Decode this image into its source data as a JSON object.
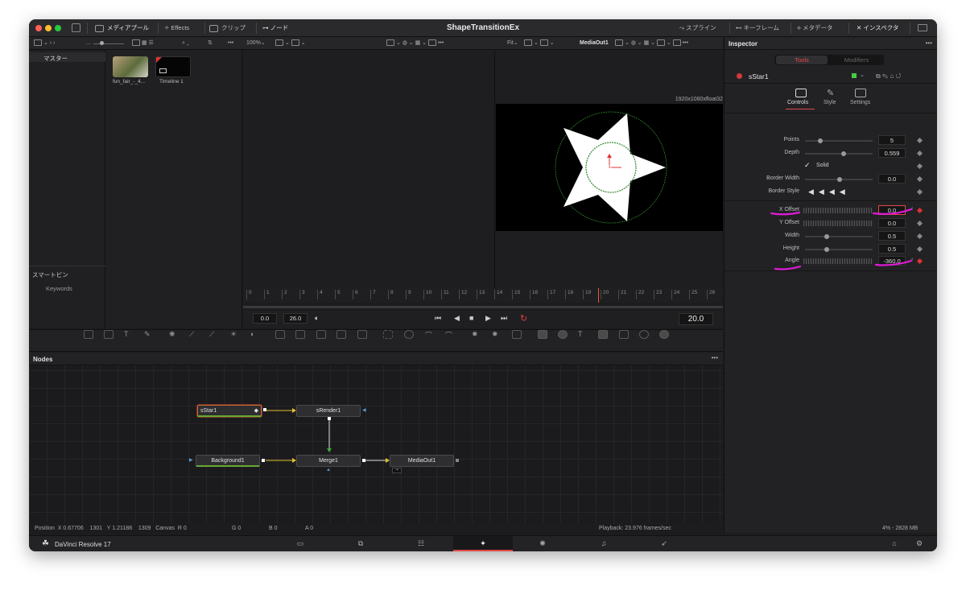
{
  "window": {
    "title": "ShapeTransitionEx"
  },
  "titlebar": {
    "media_pool": "メディアプール",
    "effects": "Effects",
    "clips": "クリップ",
    "nodes": "ノード",
    "spline": "スプライン",
    "keyframes": "キーフレーム",
    "metadata": "メタデータ",
    "inspector": "インスペクタ"
  },
  "toolbar": {
    "zoom": "100%",
    "fit": "Fit",
    "viewer_node": "MediaOut1"
  },
  "mediapool": {
    "master": "マスター",
    "smart_bins": "スマートビン",
    "keywords": "Keywords",
    "clips": [
      {
        "name": "fun_fair_-_4..."
      },
      {
        "name": "Timeline 1"
      }
    ]
  },
  "viewer": {
    "resolution": "1920x1080xfloat32"
  },
  "timeline": {
    "ticks": [
      "0",
      "1",
      "2",
      "3",
      "4",
      "5",
      "6",
      "7",
      "8",
      "9",
      "10",
      "11",
      "12",
      "13",
      "14",
      "15",
      "16",
      "17",
      "18",
      "19",
      "20",
      "21",
      "22",
      "23",
      "24",
      "25",
      "26"
    ],
    "start": "0.0",
    "end": "26.0",
    "current": "20.0"
  },
  "nodes_panel": {
    "title": "Nodes"
  },
  "nodes": {
    "sstar": "sStar1",
    "srender": "sRender1",
    "background": "Background1",
    "merge": "Merge1",
    "mediaout": "MediaOut1"
  },
  "inspector": {
    "title": "Inspector",
    "tabs": {
      "tools": "Tools",
      "modifiers": "Modifiers"
    },
    "node_name": "sStar1",
    "subtabs": {
      "controls": "Controls",
      "style": "Style",
      "settings": "Settings"
    },
    "params": {
      "points": {
        "label": "Points",
        "value": "5",
        "level": 0.2
      },
      "depth": {
        "label": "Depth",
        "value": "0.559",
        "level": 0.56
      },
      "solid": {
        "label": "Solid"
      },
      "border_width": {
        "label": "Border Width",
        "value": "0.0",
        "level": 0.5
      },
      "border_style": {
        "label": "Border Style"
      },
      "x_offset": {
        "label": "X Offset",
        "value": "0.0"
      },
      "y_offset": {
        "label": "Y Offset",
        "value": "0.0"
      },
      "width": {
        "label": "Width",
        "value": "0.5",
        "level": 0.3
      },
      "height": {
        "label": "Height",
        "value": "0.5",
        "level": 0.3
      },
      "angle": {
        "label": "Angle",
        "value": "-360.0"
      }
    }
  },
  "status": {
    "position": "Position  X 0.67706    1301   Y 1.21188    1309   Canvas  R 0",
    "g": "G 0",
    "b": "B 0",
    "a": "A 0",
    "playback": "Playback: 23.976 frames/sec",
    "memory": "4% - 2828 MB"
  },
  "footer": {
    "app": "DaVinci Resolve 17"
  },
  "colors": {
    "accent_red": "#d33a3a",
    "annotation_magenta": "#e21ad8",
    "selection_orange": "#c8643a"
  }
}
